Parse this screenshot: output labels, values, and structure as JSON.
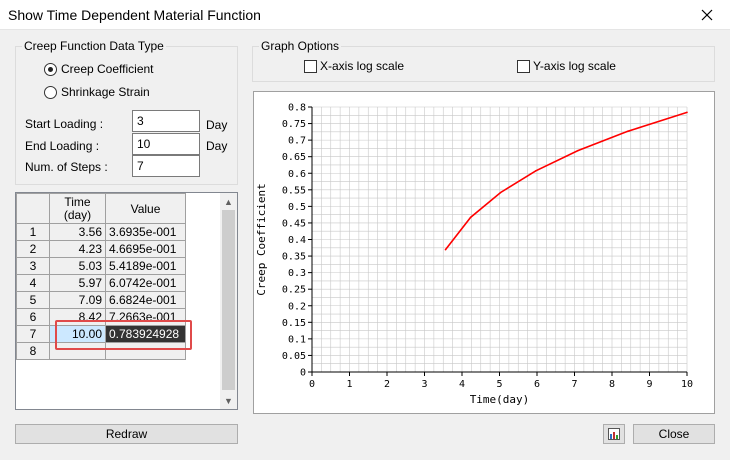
{
  "window": {
    "title": "Show Time Dependent Material Function"
  },
  "creep_group": {
    "title": "Creep Function Data Type",
    "options": [
      {
        "label": "Creep Coefficient",
        "selected": true
      },
      {
        "label": "Shrinkage Strain",
        "selected": false
      }
    ]
  },
  "fields": {
    "start": {
      "label": "Start Loading :",
      "value": "3",
      "unit": "Day"
    },
    "end": {
      "label": "End Loading :",
      "value": "10",
      "unit": "Day"
    },
    "steps": {
      "label": "Num. of Steps :",
      "value": "7"
    }
  },
  "table": {
    "headers": {
      "time": "Time\n(day)",
      "value": "Value"
    },
    "rows": [
      {
        "idx": "1",
        "time": "3.56",
        "value": "3.6935e-001"
      },
      {
        "idx": "2",
        "time": "4.23",
        "value": "4.6695e-001"
      },
      {
        "idx": "3",
        "time": "5.03",
        "value": "5.4189e-001"
      },
      {
        "idx": "4",
        "time": "5.97",
        "value": "6.0742e-001"
      },
      {
        "idx": "5",
        "time": "7.09",
        "value": "6.6824e-001"
      },
      {
        "idx": "6",
        "time": "8.42",
        "value": "7.2663e-001"
      },
      {
        "idx": "7",
        "time": "10.00",
        "value": "0.783924928"
      },
      {
        "idx": "8",
        "time": "",
        "value": ""
      }
    ]
  },
  "graph_options": {
    "title": "Graph Options",
    "x_log_label": "X-axis log scale",
    "y_log_label": "Y-axis log scale",
    "x_log": false,
    "y_log": false
  },
  "buttons": {
    "redraw": "Redraw",
    "close": "Close"
  },
  "colors": {
    "series": "#ff0000",
    "selected_cell": "#cce8ff",
    "highlight": "#e04a4a"
  },
  "chart_data": {
    "type": "line",
    "xlabel": "Time(day)",
    "ylabel": "Creep Coefficient",
    "xlim": [
      0,
      10
    ],
    "ylim": [
      0,
      0.8
    ],
    "xticks": [
      "0",
      "1",
      "2",
      "3",
      "4",
      "5",
      "6",
      "7",
      "8",
      "9",
      "10"
    ],
    "yticks": [
      "0",
      "0.05",
      "0.1",
      "0.15",
      "0.2",
      "0.25",
      "0.3",
      "0.35",
      "0.4",
      "0.45",
      "0.5",
      "0.55",
      "0.6",
      "0.65",
      "0.7",
      "0.75",
      "0.8"
    ],
    "grid": true,
    "series": [
      {
        "x": [
          3.56,
          4.23,
          5.03,
          5.97,
          7.09,
          8.42,
          10.0
        ],
        "y": [
          0.36935,
          0.46695,
          0.54189,
          0.60742,
          0.66824,
          0.72663,
          0.783925
        ]
      }
    ]
  }
}
